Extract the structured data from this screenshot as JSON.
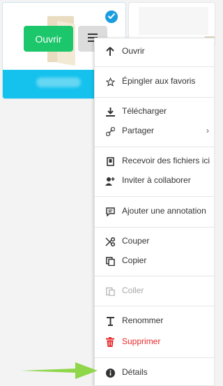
{
  "card": {
    "open_label": "Ouvrir",
    "menu_icon": "hamburger-icon",
    "selected_icon": "check-icon",
    "thumbnail": "folder-thumbnail"
  },
  "menu": {
    "items": [
      {
        "label": "Ouvrir",
        "icon": "arrow-up-icon"
      },
      {
        "label": "Épingler aux favoris",
        "icon": "star-icon"
      },
      {
        "label": "Télécharger",
        "icon": "download-icon"
      },
      {
        "label": "Partager",
        "icon": "share-icon",
        "submenu": "›"
      },
      {
        "label": "Recevoir des fichiers ici",
        "icon": "file-drop-icon"
      },
      {
        "label": "Inviter à collaborer",
        "icon": "add-user-icon"
      },
      {
        "label": "Ajouter une annotation",
        "icon": "comment-icon"
      },
      {
        "label": "Couper",
        "icon": "scissors-icon"
      },
      {
        "label": "Copier",
        "icon": "copy-icon"
      },
      {
        "label": "Coller",
        "icon": "paste-icon",
        "disabled": true
      },
      {
        "label": "Renommer",
        "icon": "text-cursor-icon"
      },
      {
        "label": "Supprimer",
        "icon": "trash-icon",
        "danger": true
      },
      {
        "label": "Détails",
        "icon": "info-icon"
      }
    ]
  },
  "colors": {
    "open_button": "#1cc66a",
    "card_footer": "#14c2ed",
    "check_badge": "#1a9ddf",
    "danger": "#e8282a",
    "arrow": "#8fd64a"
  }
}
